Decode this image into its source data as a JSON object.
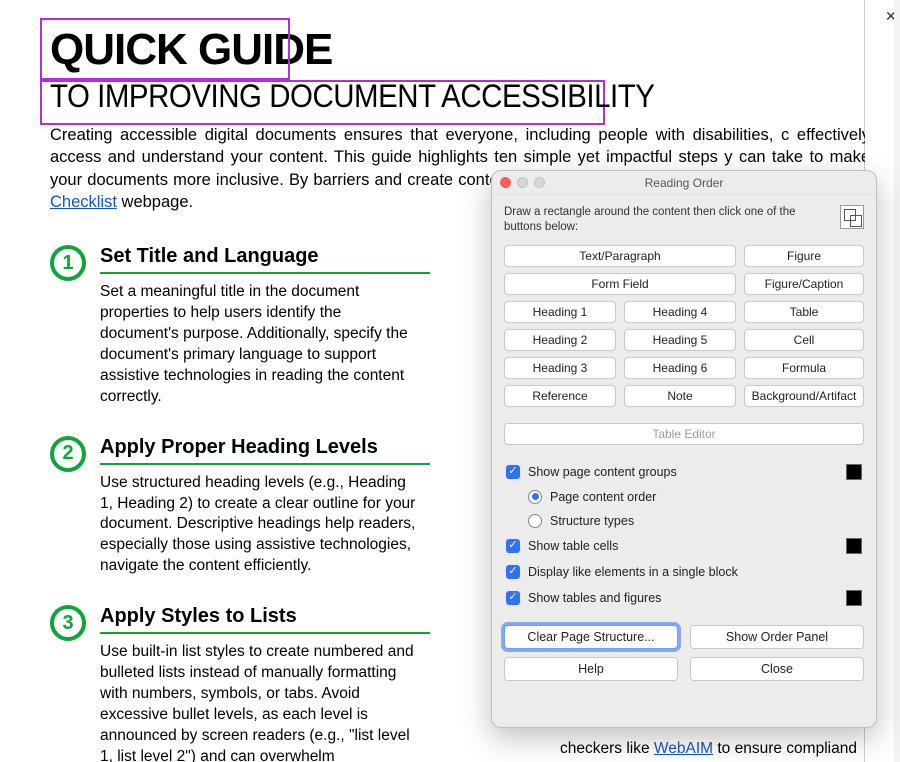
{
  "doc": {
    "title": "QUICK GUIDE",
    "subtitle": "TO IMPROVING DOCUMENT ACCESSIBILITY",
    "intro_part1": "Creating accessible digital documents ensures that everyone, including people with disabilities, c effectively access and understand your content. This guide highlights ten simple yet impactful steps y can take to make your documents more inclusive. By barriers and create content that works for everyone. out UND's ",
    "intro_link": "Accessibility Checklist",
    "intro_part2": " webpage.",
    "steps": [
      {
        "num": "1",
        "heading": "Set Title and Language",
        "body": "Set a meaningful title in the document properties to help users identify the document's purpose. Additionally, specify the document's primary language to support assistive technologies in reading the content correctly."
      },
      {
        "num": "2",
        "heading": "Apply Proper Heading Levels",
        "body": "Use structured heading levels (e.g., Heading 1, Heading 2) to create a clear outline for your document. Descriptive headings help readers, especially those using assistive technologies, navigate the content efficiently."
      },
      {
        "num": "3",
        "heading": "Apply Styles to Lists",
        "body": "Use built-in list styles to create numbered and bulleted lists instead of manually formatting with numbers, symbols, or tabs. Avoid excessive bullet levels, as each level is announced by screen readers (e.g., \"list level 1, list level 2\") and can overwhelm"
      }
    ],
    "footer_pre": "checkers like ",
    "footer_link": "WebAIM",
    "footer_post": " to ensure compliand"
  },
  "dialog": {
    "title": "Reading Order",
    "instruction": "Draw a rectangle around the content then click one of the buttons below:",
    "buttons": {
      "text_paragraph": "Text/Paragraph",
      "figure": "Figure",
      "form_field": "Form Field",
      "figure_caption": "Figure/Caption",
      "h1": "Heading 1",
      "h2": "Heading 2",
      "h3": "Heading 3",
      "h4": "Heading 4",
      "h5": "Heading 5",
      "h6": "Heading 6",
      "table": "Table",
      "cell": "Cell",
      "formula": "Formula",
      "reference": "Reference",
      "note": "Note",
      "background": "Background/Artifact",
      "table_editor": "Table Editor"
    },
    "options": {
      "show_groups": "Show page content groups",
      "radio_order": "Page content order",
      "radio_structure": "Structure types",
      "show_table_cells": "Show table cells",
      "single_block": "Display like elements in a single block",
      "show_tables_figures": "Show tables and figures"
    },
    "actions": {
      "clear": "Clear Page Structure...",
      "show_panel": "Show Order Panel",
      "help": "Help",
      "close": "Close"
    }
  }
}
